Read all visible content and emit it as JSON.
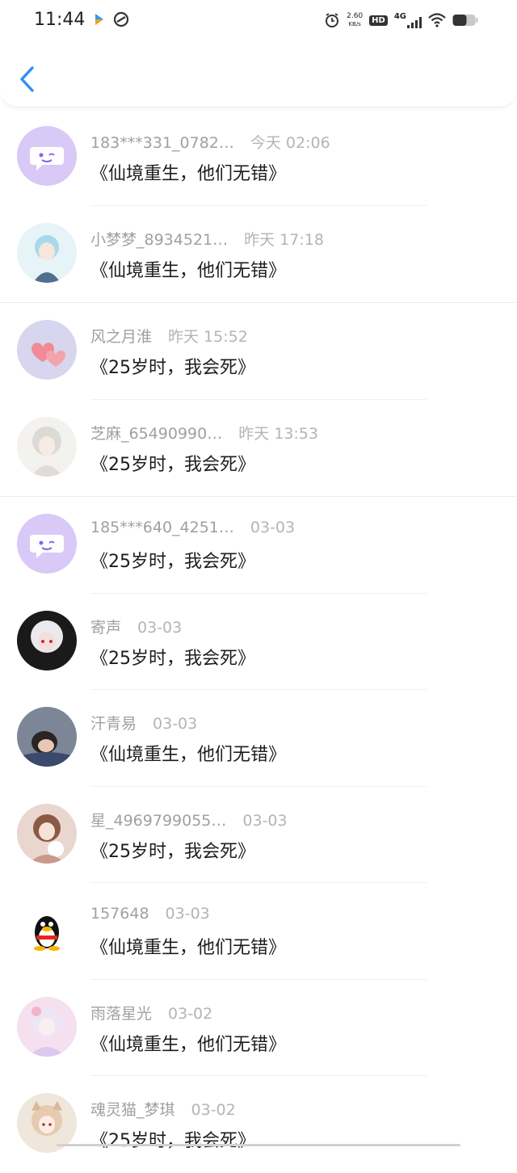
{
  "status_bar": {
    "time": "11:44",
    "net_speed_value": "2.60",
    "net_speed_unit": "KB/s",
    "hd_label": "HD",
    "network_label": "4G"
  },
  "colors": {
    "accent": "#2f8ff3",
    "default_avatar_bg": "#d9c9f6",
    "default_avatar_fg": "#8a63e8"
  },
  "header": {
    "back_icon": "chevron-left-icon"
  },
  "items": [
    {
      "username": "183***331_0782…",
      "time": "今天 02:06",
      "title": "《仙境重生，他们无错》",
      "avatar": "default-chat"
    },
    {
      "username": "小梦梦_8934521…",
      "time": "昨天 17:18",
      "title": "《仙境重生，他们无错》",
      "avatar": "anime-girl-blue"
    },
    {
      "username": "风之月淮",
      "time": "昨天 15:52",
      "title": "《25岁时，我会死》",
      "avatar": "pink-hearts"
    },
    {
      "username": "芝麻_65490990…",
      "time": "昨天 13:53",
      "title": "《25岁时，我会死》",
      "avatar": "anime-girl-white"
    },
    {
      "username": "185***640_4251…",
      "time": "03-03",
      "title": "《25岁时，我会死》",
      "avatar": "default-chat"
    },
    {
      "username": "寄声",
      "time": "03-03",
      "title": "《25岁时，我会死》",
      "avatar": "anime-boy-white"
    },
    {
      "username": "汗青易",
      "time": "03-03",
      "title": "《仙境重生，他们无错》",
      "avatar": "sleeping-child"
    },
    {
      "username": "星_4969799055…",
      "time": "03-03",
      "title": "《25岁时，我会死》",
      "avatar": "anime-girl-cat"
    },
    {
      "username": "157648",
      "time": "03-03",
      "title": "《仙境重生，他们无错》",
      "avatar": "penguin"
    },
    {
      "username": "雨落星光",
      "time": "03-02",
      "title": "《仙境重生，他们无错》",
      "avatar": "anime-girl-pink"
    },
    {
      "username": "魂灵猫_梦琪",
      "time": "03-02",
      "title": "《25岁时，我会死》",
      "avatar": "anime-catgirl"
    }
  ]
}
